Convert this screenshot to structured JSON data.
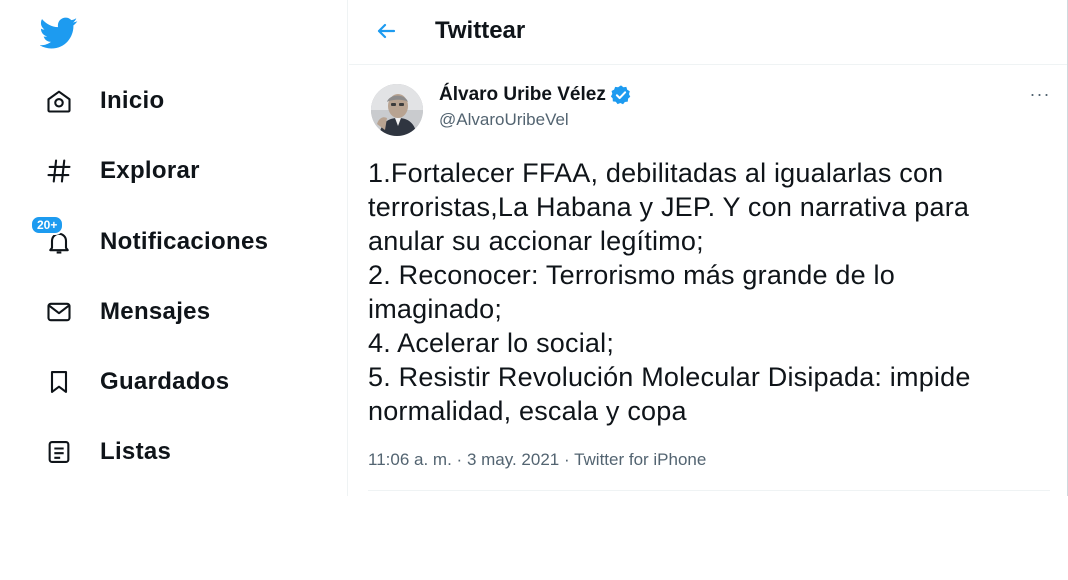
{
  "sidebar": {
    "items": [
      {
        "label": "Inicio",
        "icon": "home-icon"
      },
      {
        "label": "Explorar",
        "icon": "hashtag-icon"
      },
      {
        "label": "Notificaciones",
        "icon": "bell-icon",
        "badge": "20+"
      },
      {
        "label": "Mensajes",
        "icon": "envelope-icon"
      },
      {
        "label": "Guardados",
        "icon": "bookmark-icon"
      },
      {
        "label": "Listas",
        "icon": "list-icon"
      }
    ]
  },
  "header": {
    "title": "Twittear"
  },
  "tweet": {
    "author_name": "Álvaro Uribe Vélez",
    "handle": "@AlvaroUribeVel",
    "text_lines": [
      "1.Fortalecer FFAA, debilitadas al igualarlas con",
      "terroristas,La Habana y JEP. Y con narrativa para",
      "anular su accionar legítimo;",
      "2. Reconocer: Terrorismo más grande de lo",
      "imaginado;",
      "4. Acelerar lo social;",
      "5. Resistir Revolución Molecular Disipada: impide",
      "normalidad, escala y copa"
    ],
    "time": "11:06 a. m.",
    "separator": "·",
    "date": "3 may. 2021",
    "source": "Twitter for iPhone",
    "more": "···"
  },
  "colors": {
    "accent": "#1d9bf0",
    "text": "#0f1419",
    "secondary": "#536471"
  }
}
